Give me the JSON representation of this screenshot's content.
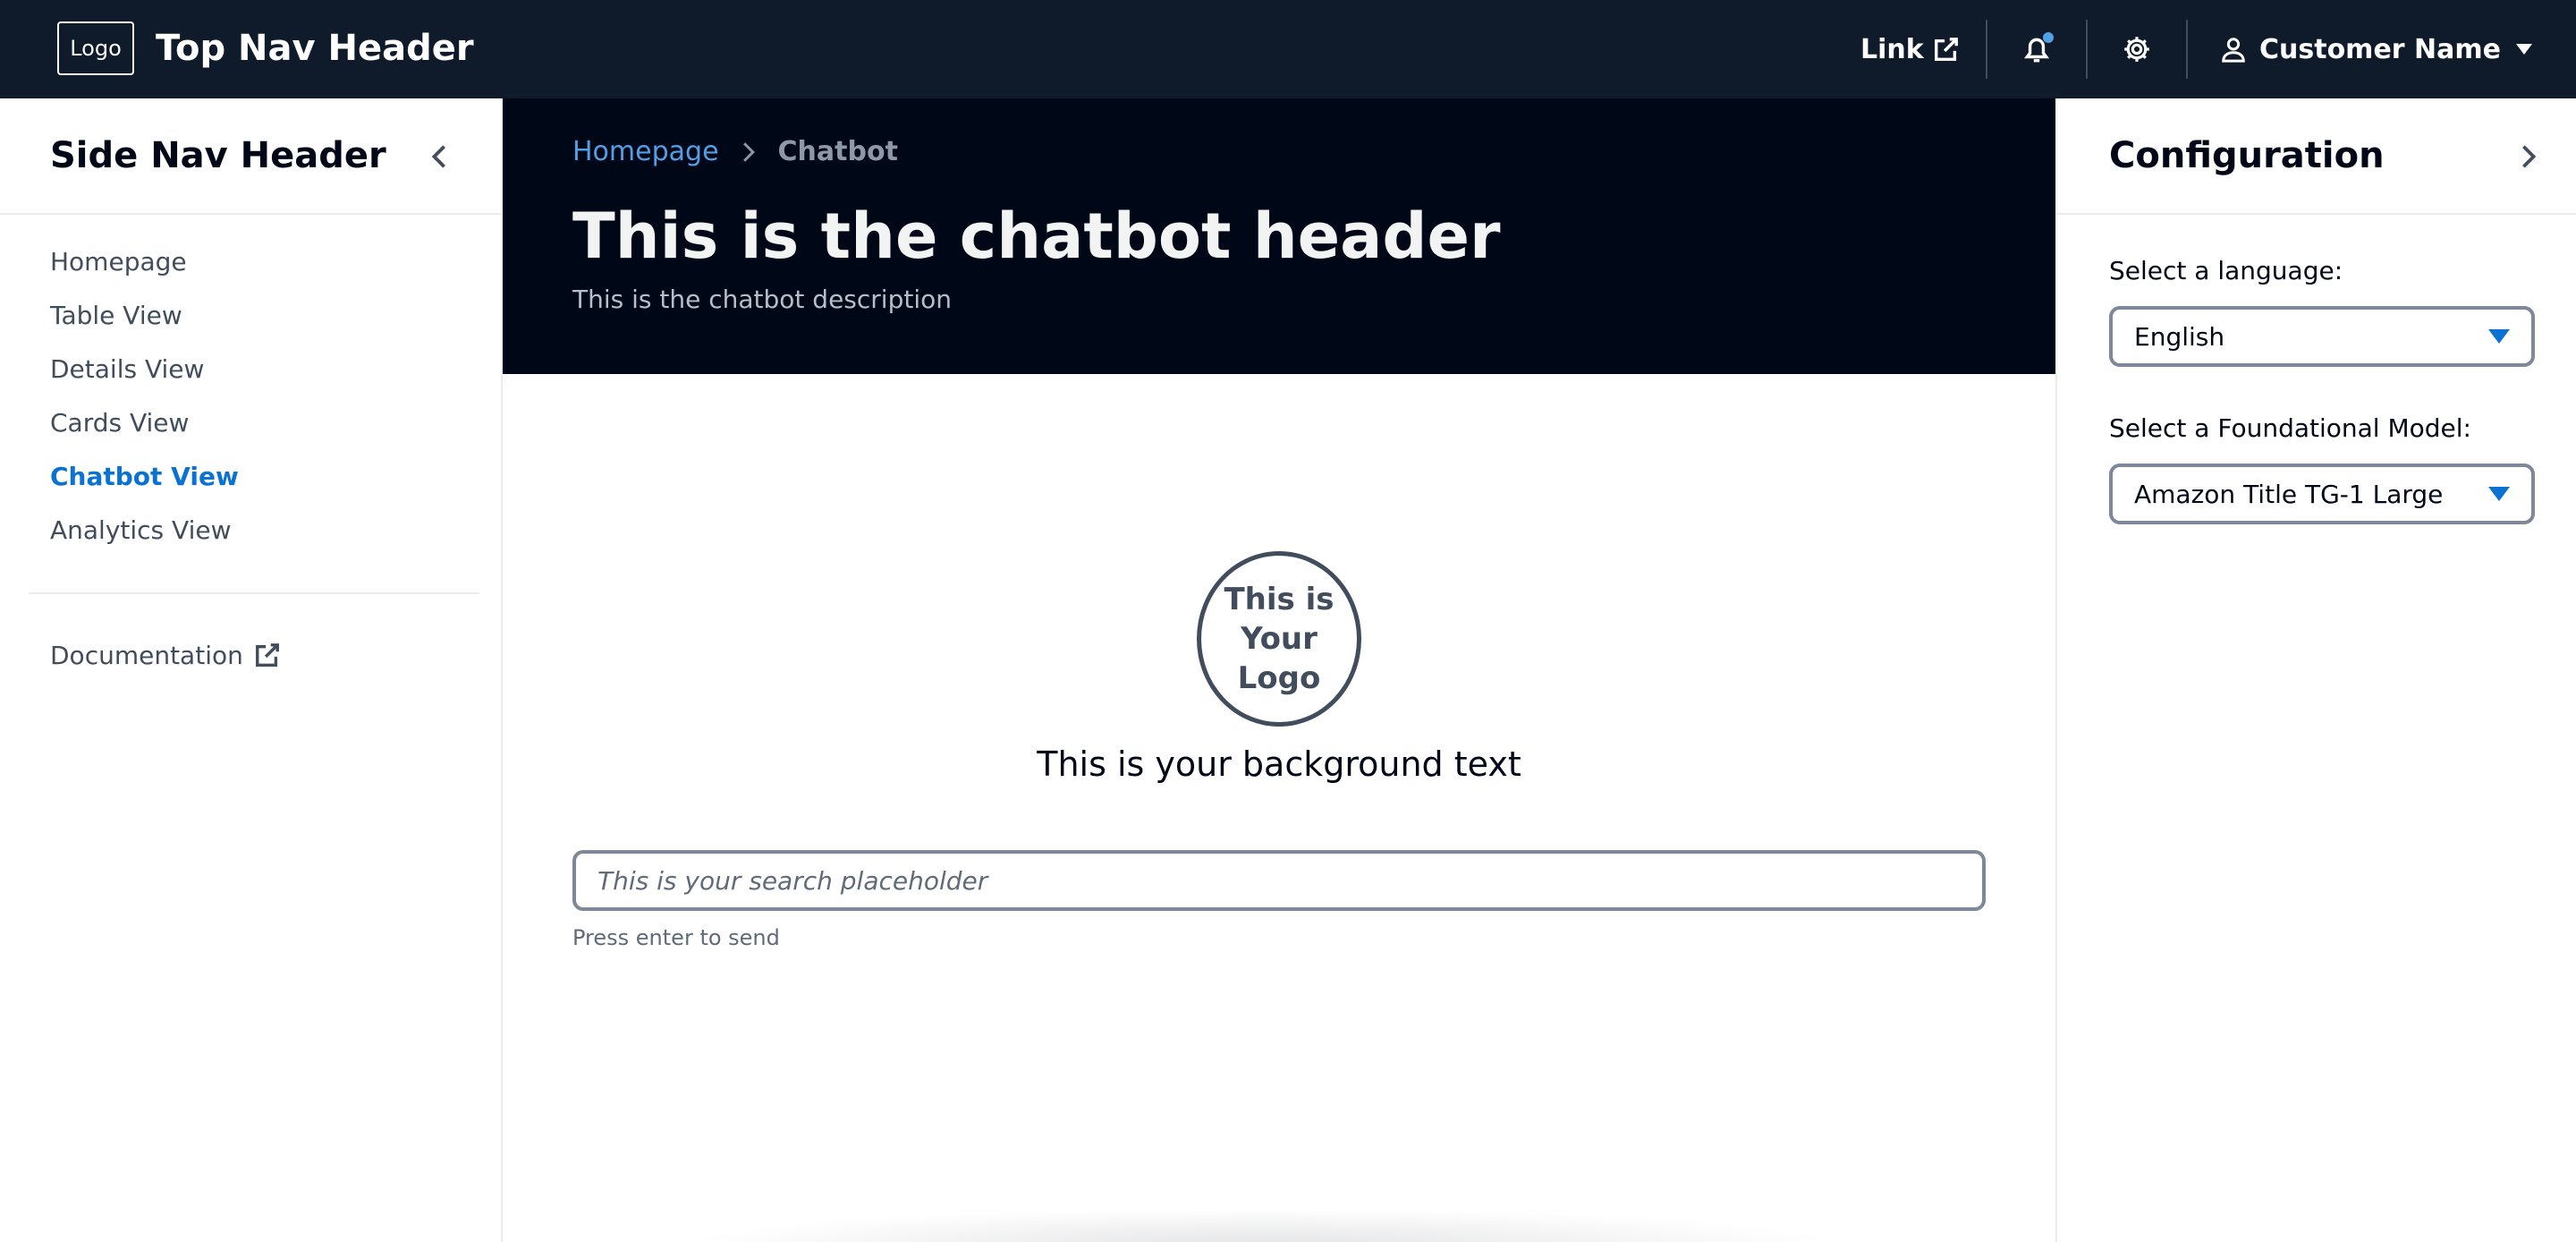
{
  "top_nav": {
    "logo_text": "Logo",
    "title": "Top Nav Header",
    "link_label": "Link",
    "notifications_icon": "bell-icon",
    "settings_icon": "gear-icon",
    "user_name": "Customer Name"
  },
  "side_nav": {
    "header": "Side Nav Header",
    "items": [
      {
        "label": "Homepage",
        "active": false
      },
      {
        "label": "Table View",
        "active": false
      },
      {
        "label": "Details View",
        "active": false
      },
      {
        "label": "Cards View",
        "active": false
      },
      {
        "label": "Chatbot View",
        "active": true
      },
      {
        "label": "Analytics View",
        "active": false
      }
    ],
    "documentation_label": "Documentation"
  },
  "main": {
    "breadcrumb": {
      "home": "Homepage",
      "current": "Chatbot"
    },
    "title": "This is the chatbot header",
    "description": "This is the chatbot description",
    "chat_logo_text": "This is\nYour\nLogo",
    "background_text": "This is your background text",
    "search_placeholder": "This is your search placeholder",
    "search_value": "",
    "search_hint": "Press enter to send"
  },
  "config": {
    "title": "Configuration",
    "language_label": "Select a language:",
    "language_value": "English",
    "model_label": "Select a Foundational Model:",
    "model_value": "Amazon Title TG-1 Large"
  },
  "colors": {
    "top_nav_bg": "#0f1b2a",
    "hero_bg": "#000716",
    "accent": "#0972d3",
    "link": "#539fe5"
  }
}
